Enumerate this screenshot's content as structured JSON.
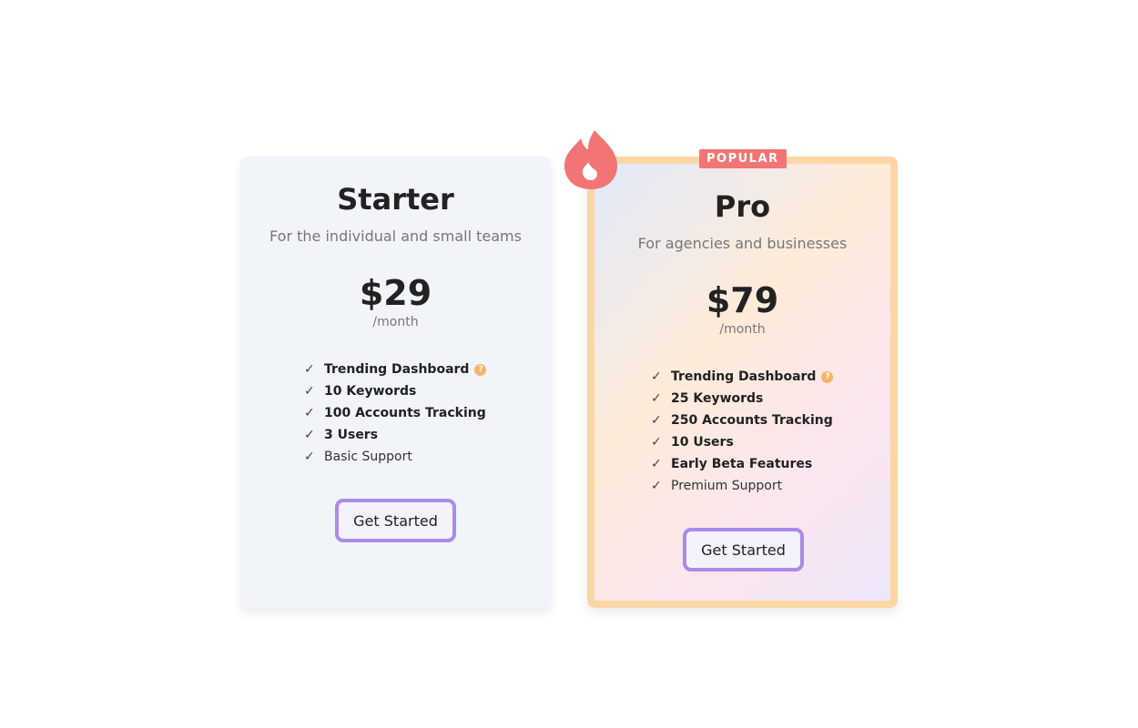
{
  "plans": [
    {
      "name": "Starter",
      "description": "For the individual and small teams",
      "price": "$29",
      "period": "/month",
      "features": [
        {
          "label": "Trending Dashboard",
          "bold": true,
          "help": true
        },
        {
          "label": "10 Keywords",
          "bold": true
        },
        {
          "label": "100 Accounts Tracking",
          "bold": true
        },
        {
          "label": "3 Users",
          "bold": true
        },
        {
          "label": "Basic Support",
          "bold": false
        }
      ],
      "cta": "Get Started"
    },
    {
      "name": "Pro",
      "badge": "POPULAR",
      "description": "For agencies and businesses",
      "price": "$79",
      "period": "/month",
      "features": [
        {
          "label": "Trending Dashboard",
          "bold": true,
          "help": true
        },
        {
          "label": "25 Keywords",
          "bold": true
        },
        {
          "label": "250 Accounts Tracking",
          "bold": true
        },
        {
          "label": "10 Users",
          "bold": true
        },
        {
          "label": "Early Beta Features",
          "bold": true
        },
        {
          "label": "Premium Support",
          "bold": false
        }
      ],
      "cta": "Get Started"
    }
  ],
  "icons": {
    "check": "checkmark-icon",
    "help": "question-icon",
    "popular": "fire-icon"
  },
  "colors": {
    "accent": "#a98be8",
    "badge": "#f27474",
    "pro_border": "#fdd6a6",
    "help": "#f6b46b"
  }
}
